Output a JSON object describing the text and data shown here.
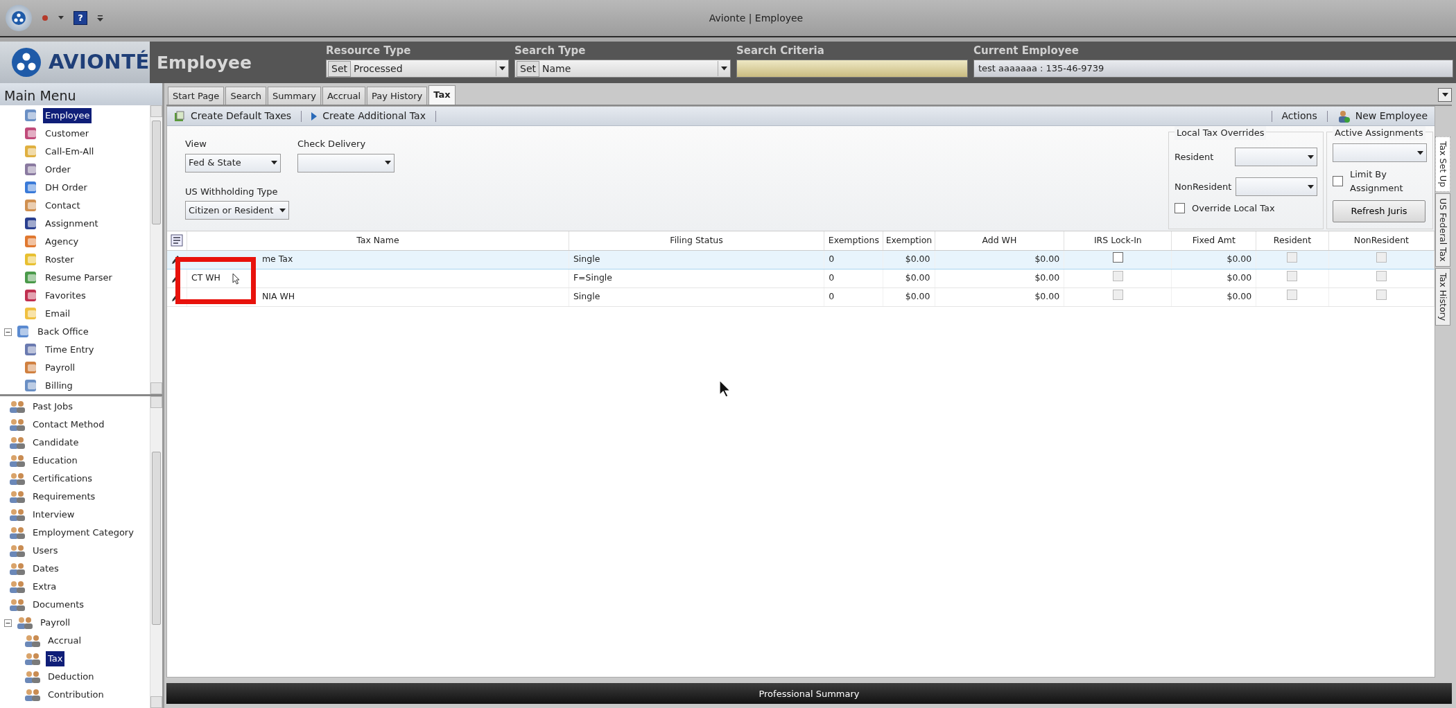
{
  "window": {
    "title": "Avionte | Employee",
    "help_glyph": "?"
  },
  "brand": {
    "name": "AVIONTÉ"
  },
  "module": {
    "title": "Employee"
  },
  "header_fields": [
    {
      "kind": "dropdown",
      "label": "Resource Type",
      "prefix": "Set",
      "value": "Processed"
    },
    {
      "kind": "dropdown",
      "label": "Search Type",
      "prefix": "Set",
      "value": "Name"
    },
    {
      "kind": "search",
      "label": "Search Criteria"
    },
    {
      "kind": "display",
      "label": "Current Employee",
      "value": "test  aaaaaaa : 135-46-9739"
    }
  ],
  "sidebar": {
    "title": "Main Menu",
    "top_tree": [
      {
        "label": "Employee",
        "selected": true
      },
      {
        "label": "Customer",
        "selected": false
      },
      {
        "label": "Call-Em-All",
        "selected": false
      },
      {
        "label": "Order",
        "selected": false
      },
      {
        "label": "DH Order",
        "selected": false
      },
      {
        "label": "Contact",
        "selected": false
      },
      {
        "label": "Assignment",
        "selected": false
      },
      {
        "label": "Agency",
        "selected": false
      },
      {
        "label": "Roster",
        "selected": false
      },
      {
        "label": "Resume Parser",
        "selected": false
      },
      {
        "label": "Favorites",
        "selected": false
      },
      {
        "label": "Email",
        "selected": false
      },
      {
        "label": "Back Office",
        "selected": false,
        "expanded": true,
        "children": [
          {
            "label": "Time Entry",
            "selected": false
          },
          {
            "label": "Payroll",
            "selected": false
          },
          {
            "label": "Billing",
            "selected": false
          }
        ]
      }
    ],
    "bottom_tree": [
      {
        "label": "Past Jobs",
        "selected": false
      },
      {
        "label": "Contact Method",
        "selected": false
      },
      {
        "label": "Candidate",
        "selected": false
      },
      {
        "label": "Education",
        "selected": false
      },
      {
        "label": "Certifications",
        "selected": false
      },
      {
        "label": "Requirements",
        "selected": false
      },
      {
        "label": "Interview",
        "selected": false
      },
      {
        "label": "Employment Category",
        "selected": false
      },
      {
        "label": "Users",
        "selected": false
      },
      {
        "label": "Dates",
        "selected": false
      },
      {
        "label": "Extra",
        "selected": false
      },
      {
        "label": "Documents",
        "selected": false
      },
      {
        "label": "Payroll",
        "selected": false,
        "expanded": true,
        "children": [
          {
            "label": "Accrual",
            "selected": false
          },
          {
            "label": "Tax",
            "selected": true
          },
          {
            "label": "Deduction",
            "selected": false
          },
          {
            "label": "Contribution",
            "selected": false
          }
        ]
      }
    ]
  },
  "tabs": [
    {
      "label": "Start Page",
      "selected": false
    },
    {
      "label": "Search",
      "selected": false
    },
    {
      "label": "Summary",
      "selected": false
    },
    {
      "label": "Accrual",
      "selected": false
    },
    {
      "label": "Pay History",
      "selected": false
    },
    {
      "label": "Tax",
      "selected": true
    }
  ],
  "toolbar": {
    "left": [
      "Create Default Taxes",
      "Create Additional Tax"
    ],
    "right": [
      "Actions",
      "New Employee"
    ]
  },
  "filters": {
    "view": {
      "label": "View",
      "value": "Fed & State"
    },
    "check_delivery": {
      "label": "Check Delivery"
    },
    "withholding": {
      "label": "US Withholding Type",
      "value": "Citizen or Resident"
    },
    "local_overrides": {
      "title": "Local Tax Overrides",
      "resident_label": "Resident",
      "nonresident_label": "NonResident",
      "override": {
        "label": "Override Local Tax",
        "checked": false
      }
    },
    "active_assignments": {
      "title": "Active Assignments",
      "limit": {
        "label": "Limit By Assignment",
        "checked": false
      },
      "button": "Refresh Juris"
    }
  },
  "table": {
    "columns": [
      "Tax Name",
      "Filing Status",
      "Exemptions",
      "Exemption",
      "Add WH",
      "IRS Lock-In",
      "Fixed Amt",
      "Resident",
      "NonResident"
    ],
    "rows": [
      {
        "kind": "cut",
        "selected": true,
        "tax_name": "me Tax",
        "filing_status": "Single",
        "exemptions": "0",
        "exemption": "$0.00",
        "add_wh": "$0.00",
        "irs_lock_in": {
          "checked": false,
          "disabled": false
        },
        "fixed_amt": "$0.00",
        "resident": {
          "checked": false,
          "disabled": true
        },
        "nonresident": {
          "checked": false,
          "disabled": true
        }
      },
      {
        "kind": "plain",
        "selected": false,
        "tax_name": "CT WH",
        "filing_status": "F=Single",
        "exemptions": "0",
        "exemption": "$0.00",
        "add_wh": "$0.00",
        "irs_lock_in": {
          "checked": false,
          "disabled": true
        },
        "fixed_amt": "$0.00",
        "resident": {
          "checked": false,
          "disabled": true
        },
        "nonresident": {
          "checked": false,
          "disabled": true
        }
      },
      {
        "kind": "cut",
        "selected": false,
        "tax_name": "NIA WH",
        "filing_status": "Single",
        "exemptions": "0",
        "exemption": "$0.00",
        "add_wh": "$0.00",
        "irs_lock_in": {
          "checked": false,
          "disabled": true
        },
        "fixed_amt": "$0.00",
        "resident": {
          "checked": false,
          "disabled": true
        },
        "nonresident": {
          "checked": false,
          "disabled": true
        }
      }
    ]
  },
  "side_tabs": [
    {
      "label": "Tax Set Up",
      "selected": true
    },
    {
      "label": "US Federal Tax",
      "selected": false
    },
    {
      "label": "Tax History",
      "selected": false
    }
  ],
  "footer_bar": {
    "title": "Professional Summary"
  }
}
